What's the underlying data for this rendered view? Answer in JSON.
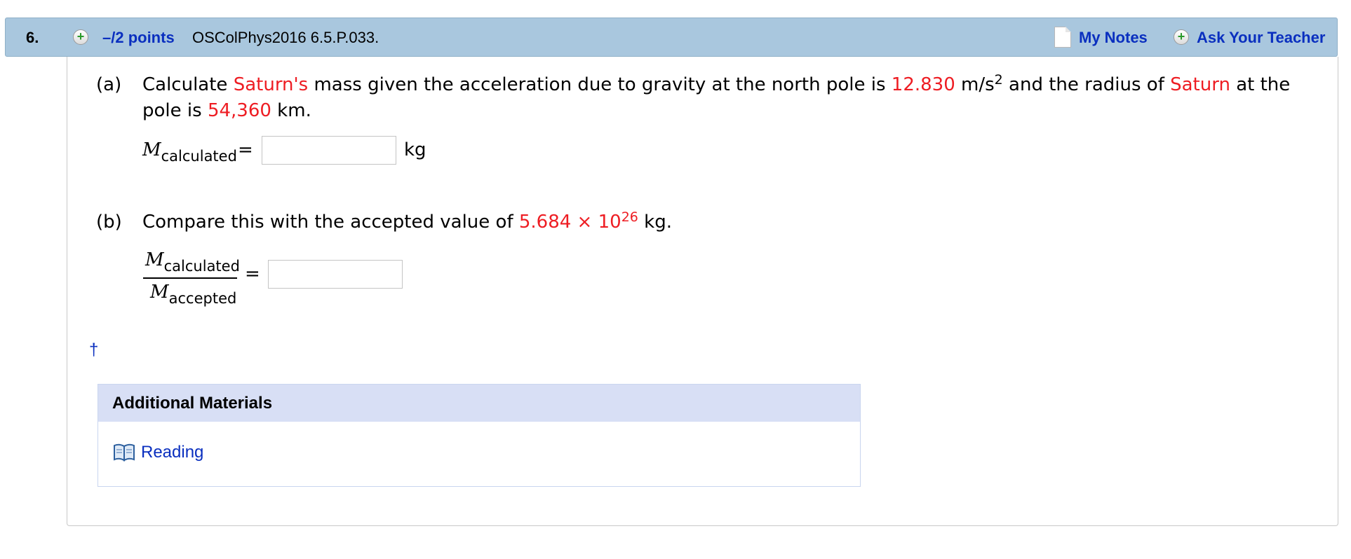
{
  "question": {
    "number": "6.",
    "points": "–/2 points",
    "id": "OSColPhys2016 6.5.P.033.",
    "my_notes": "My Notes",
    "ask_teacher": "Ask Your Teacher"
  },
  "part_a": {
    "label": "(a)",
    "t1": "Calculate ",
    "planet": "Saturn's",
    "t2": " mass given the acceleration due to gravity at the north pole is ",
    "g_value": "12.830",
    "t3": " m/s",
    "exp": "2",
    "t4": " and the radius of ",
    "planet2": "Saturn",
    "t5": " at the",
    "t6": "pole is ",
    "radius": "54,360",
    "t7": " km.",
    "m_symbol": "M",
    "m_sub": "calculated",
    "equals": "=",
    "unit": "kg",
    "answer": ""
  },
  "part_b": {
    "label": "(b)",
    "t1": "Compare this with the accepted value of ",
    "value": "5.684 × 10",
    "exp": "26",
    "t2": " kg.",
    "num_symbol": "M",
    "num_sub": "calculated",
    "den_symbol": "M",
    "den_sub": "accepted",
    "equals": "=",
    "answer": ""
  },
  "dagger": "†",
  "additional": {
    "title": "Additional Materials",
    "link": "Reading",
    "icon": "book-icon"
  }
}
